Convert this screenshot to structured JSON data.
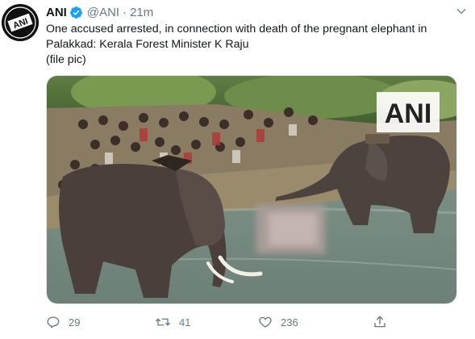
{
  "tweet": {
    "author": {
      "name": "ANI",
      "handle": "@ANI",
      "time": "21m",
      "avatar_text": "ANI",
      "avatar_icon": "ani-logo-icon",
      "verified_icon": "verified-badge-icon"
    },
    "text_lines": [
      "One accused arrested, in connection with death of the pregnant elephant in",
      "Palakkad: Kerala Forest Minister K Raju",
      "(file pic)"
    ],
    "media": {
      "watermark": "ANI",
      "icon": "elephants-in-river-photo"
    },
    "actions": {
      "reply_count": "29",
      "retweet_count": "41",
      "like_count": "236",
      "reply_icon": "reply-icon",
      "retweet_icon": "retweet-icon",
      "like_icon": "heart-icon",
      "share_icon": "share-icon"
    },
    "menu_icon": "chevron-down-icon",
    "colors": {
      "accent": "#1da1f2",
      "muted_text": "#657786",
      "primary_text": "#14171a"
    }
  }
}
